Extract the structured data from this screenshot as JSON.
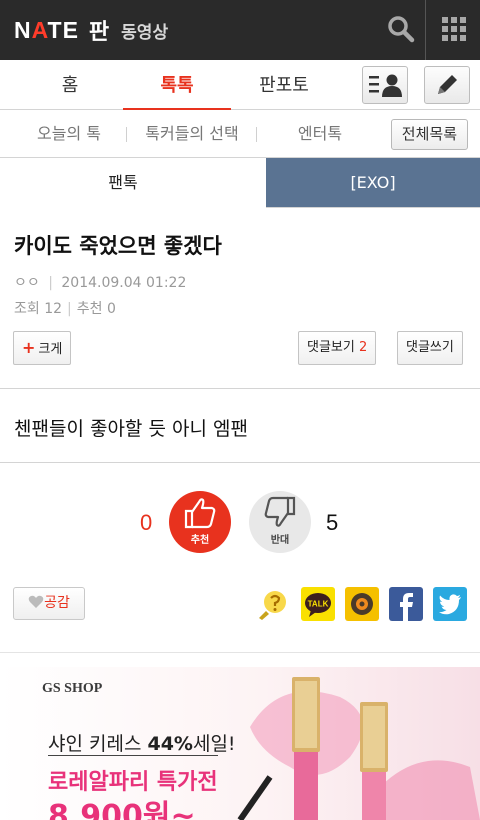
{
  "header": {
    "logo_text": "NATE",
    "logo_pan": "판",
    "video_label": "동영상"
  },
  "main_tabs": [
    {
      "label": "홈",
      "active": false
    },
    {
      "label": "톡톡",
      "active": true
    },
    {
      "label": "판포토",
      "active": false
    }
  ],
  "sub_tabs": {
    "items": [
      "오늘의 톡",
      "톡커들의 선택",
      "엔터톡"
    ],
    "all_button": "전체목록"
  },
  "breadcrumb": {
    "left": "팬톡",
    "right": "[EXO]"
  },
  "post": {
    "title": "카이도 죽었으면 좋겠다",
    "author": "ㅇㅇ",
    "date": "2014.09.04 01:22",
    "views_label": "조회",
    "views": "12",
    "recommend_label": "추천",
    "recommend_count": "0",
    "enlarge_label": "크게",
    "comments_view_label": "댓글보기",
    "comments_count": "2",
    "comment_write_label": "댓글쓰기",
    "body": "첸팬들이 좋아할 듯 아니 엠팬"
  },
  "vote": {
    "up_count": "0",
    "up_label": "추천",
    "down_count": "5",
    "down_label": "반대"
  },
  "share": {
    "like_label": "공감",
    "icons": [
      "kakao-story-icon",
      "kakao-talk-icon",
      "kakao-camera-icon",
      "facebook-icon",
      "twitter-icon"
    ],
    "talk_text": "TALK"
  },
  "ad": {
    "brand": "GS SHOP",
    "line1_prefix": "샤인 키레스 ",
    "line1_emph": "44%",
    "line1_suffix": "세일!",
    "line2": "로레알파리 특가전",
    "line3": "8,900원~"
  },
  "colors": {
    "accent": "#e8321e",
    "header_bg": "#2a2a2a",
    "breadcrumb_bg": "#5a7392",
    "ad_pink": "#e8327a"
  }
}
